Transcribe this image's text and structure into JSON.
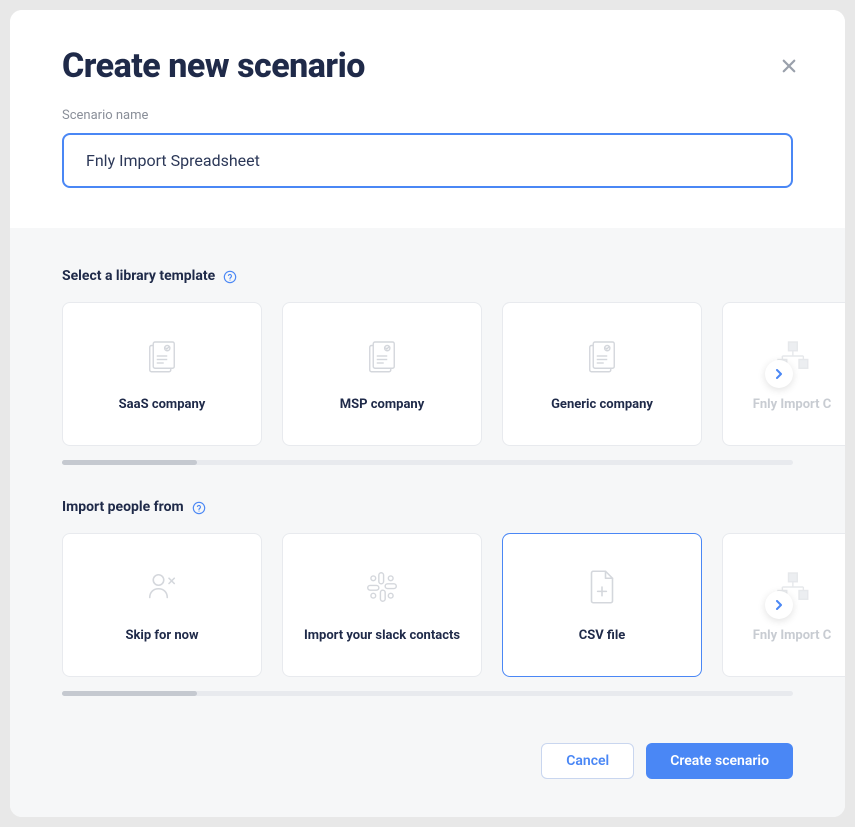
{
  "modal": {
    "title": "Create new scenario",
    "scenario_name_label": "Scenario name",
    "scenario_name_value": "Fnly Import Spreadsheet",
    "scenario_name_misspelled_prefix": "Fnly"
  },
  "sections": {
    "templates": {
      "title": "Select a library template",
      "cards": [
        {
          "label": "SaaS company"
        },
        {
          "label": "MSP company"
        },
        {
          "label": "Generic company"
        },
        {
          "label": "Fnly Import C"
        }
      ]
    },
    "import": {
      "title": "Import people from",
      "cards": [
        {
          "label": "Skip for now"
        },
        {
          "label": "Import your slack contacts"
        },
        {
          "label": "CSV file",
          "selected": true
        },
        {
          "label": "Fnly Import C"
        }
      ]
    }
  },
  "footer": {
    "cancel": "Cancel",
    "create": "Create scenario"
  }
}
